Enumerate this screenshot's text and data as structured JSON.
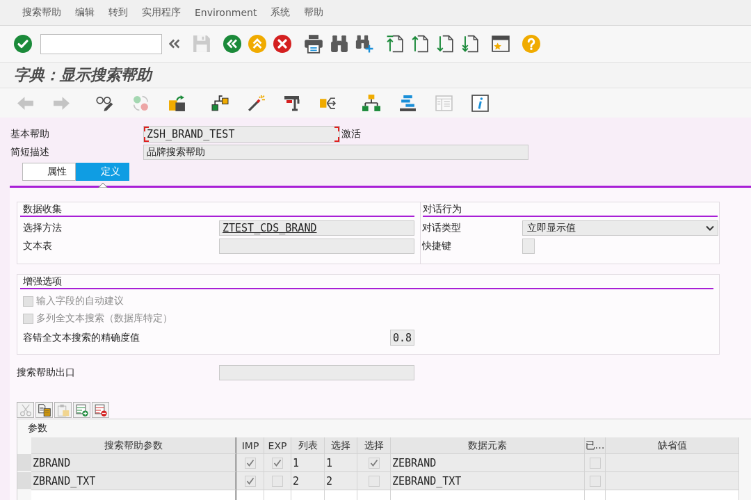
{
  "menu_bar": [
    "搜索帮助",
    "编辑",
    "转到",
    "实用程序",
    "Environment",
    "系统",
    "帮助"
  ],
  "standard_toolbar": {
    "groups": [
      {
        "buttons": [
          {
            "kind": "enter",
            "disabled": false
          },
          {
            "kind": "command_field",
            "disabled": false
          },
          {
            "kind": "collapse",
            "disabled": false
          }
        ]
      },
      {
        "buttons": [
          {
            "kind": "save",
            "disabled": true
          }
        ]
      },
      {
        "buttons": [
          {
            "kind": "back",
            "disabled": false
          },
          {
            "kind": "exit",
            "disabled": false
          },
          {
            "kind": "cancel",
            "disabled": false
          }
        ]
      },
      {
        "buttons": [
          {
            "kind": "print",
            "disabled": false
          },
          {
            "kind": "find",
            "disabled": false
          },
          {
            "kind": "find_next",
            "disabled": false
          }
        ]
      },
      {
        "buttons": [
          {
            "kind": "first_page",
            "disabled": false
          },
          {
            "kind": "previous_page",
            "disabled": false
          },
          {
            "kind": "next_page",
            "disabled": false
          },
          {
            "kind": "last_page",
            "disabled": false
          }
        ]
      },
      {
        "buttons": [
          {
            "kind": "new_session",
            "disabled": false
          }
        ]
      },
      {
        "buttons": [
          {
            "kind": "help",
            "disabled": false
          }
        ]
      }
    ]
  },
  "title": "字典：显示搜索帮助",
  "application_toolbar": {
    "groups": [
      {
        "buttons": [
          {
            "kind": "back",
            "disabled": true
          },
          {
            "kind": "forward",
            "disabled": true
          }
        ]
      },
      {
        "buttons": [
          {
            "kind": "glasses",
            "disabled": false
          },
          {
            "kind": "swap",
            "disabled": true
          },
          {
            "kind": "import",
            "disabled": false
          }
        ]
      },
      {
        "buttons": [
          {
            "kind": "hierarchy",
            "disabled": false
          },
          {
            "kind": "wand",
            "disabled": false
          },
          {
            "kind": "clamp",
            "disabled": false
          },
          {
            "kind": "branch",
            "disabled": false
          }
        ]
      },
      {
        "buttons": [
          {
            "kind": "orgchart",
            "disabled": false
          },
          {
            "kind": "layers",
            "disabled": false
          },
          {
            "kind": "doclist",
            "disabled": true
          },
          {
            "kind": "info",
            "disabled": false
          }
        ]
      }
    ]
  },
  "header_fields": [
    {
      "label": "基本帮助",
      "value": "ZSH_BRAND_TEST",
      "status": "激活",
      "focused": true
    },
    {
      "label": "简短描述",
      "value": "品牌搜索帮助",
      "focused": false
    }
  ],
  "tabs": [
    {
      "label": "属性",
      "selected": false
    },
    {
      "label": "定义",
      "selected": true
    }
  ],
  "data_collection": {
    "title": "数据收集",
    "fields": [
      {
        "label": "选择方法",
        "value": "ZTEST_CDS_BRAND",
        "link": true
      },
      {
        "label": "文本表"
      }
    ]
  },
  "dialog_behavior": {
    "title": "对话行为",
    "fields": [
      {
        "kind": "dropdown",
        "label": "对话类型",
        "value": "立即显示值"
      },
      {
        "kind": "field",
        "label": "快捷键"
      }
    ]
  },
  "enhanced_options": {
    "title": "增强选项",
    "checkboxes": [
      {
        "label": "输入字段的自动建议",
        "checked": false,
        "disabled": true
      },
      {
        "label": "多列全文本搜索（数据库特定）",
        "checked": false,
        "disabled": true
      }
    ],
    "precision": {
      "label": "容错全文本搜索的精确度值",
      "value": "0.8"
    }
  },
  "exit_field": {
    "label": "搜索帮助出口"
  },
  "parameters": {
    "toolbar": [
      {
        "kind": "cut",
        "disabled": true
      },
      {
        "kind": "copy",
        "disabled": false
      },
      {
        "kind": "paste",
        "disabled": true
      },
      {
        "kind": "insert_row",
        "disabled": false
      },
      {
        "kind": "delete_row",
        "disabled": false
      }
    ],
    "title": "参数",
    "columns": [
      "搜索帮助参数",
      "IMP",
      "EXP",
      "列表",
      "选择",
      "选择",
      "数据元素",
      "已…",
      "缺省值"
    ],
    "rows": [
      {
        "cells": [
          {
            "kind": "text",
            "text": "ZBRAND"
          },
          {
            "kind": "check",
            "checked": true
          },
          {
            "kind": "check",
            "checked": true
          },
          {
            "kind": "text",
            "text": "1"
          },
          {
            "kind": "text",
            "text": "1"
          },
          {
            "kind": "check",
            "checked": true
          },
          {
            "kind": "text",
            "text": "ZEBRAND"
          },
          {
            "kind": "check",
            "checked": false
          }
        ]
      },
      {
        "cells": [
          {
            "kind": "text",
            "text": "ZBRAND_TXT"
          },
          {
            "kind": "check",
            "checked": true
          },
          {
            "kind": "check",
            "checked": false
          },
          {
            "kind": "text",
            "text": "2"
          },
          {
            "kind": "text",
            "text": "2"
          },
          {
            "kind": "check",
            "checked": false
          },
          {
            "kind": "text",
            "text": "ZEBRAND_TXT"
          },
          {
            "kind": "check",
            "checked": false
          }
        ]
      }
    ]
  }
}
